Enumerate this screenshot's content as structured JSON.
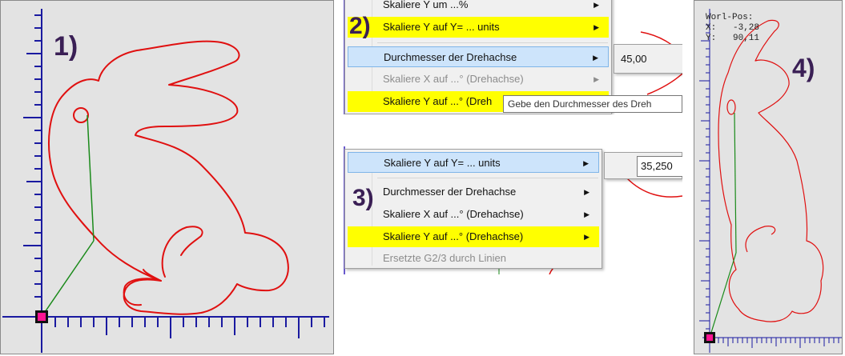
{
  "panel1": {
    "label": "1)"
  },
  "panel2": {
    "label": "2)",
    "menu_items": [
      {
        "label": "Skaliere Y um ...%",
        "state": "normal"
      },
      {
        "label": "Skaliere Y auf Y= ... units",
        "state": "highlighted-yellow"
      },
      {
        "label": "Durchmesser der Drehachse",
        "state": "hover"
      },
      {
        "label": "Skaliere X auf ...° (Drehachse)",
        "state": "disabled"
      },
      {
        "label": "Skaliere Y auf ...° (Dreh",
        "state": "highlighted-yellow"
      }
    ],
    "submenu_value": "45,00",
    "tooltip": "Gebe den Durchmesser des Dreh"
  },
  "panel3": {
    "label": "3)",
    "menu_items": [
      {
        "label": "Skaliere Y auf Y= ... units",
        "state": "hover"
      },
      {
        "label": "Durchmesser der Drehachse",
        "state": "normal"
      },
      {
        "label": "Skaliere X auf ...° (Drehachse)",
        "state": "normal"
      },
      {
        "label": "Skaliere Y auf ...° (Drehachse)",
        "state": "highlighted-yellow"
      },
      {
        "label": "Ersetzte G2/3 durch Linien",
        "state": "disabled"
      }
    ],
    "submenu_value": "35,250"
  },
  "panel4": {
    "label": "4)",
    "pos_title": "Worl-Pos:",
    "pos_x_label": "X:",
    "pos_x_value": "-3,28",
    "pos_y_label": "Y:",
    "pos_y_value": "90,11"
  },
  "colors": {
    "canvas_bg": "#e3e3e3",
    "ruler": "#1a1aa0",
    "contour": "#e01010",
    "path": "#1a8a1a",
    "origin_marker": "#ff1493",
    "highlight_yellow": "#ffff00",
    "hover_blue": "#cde4fb",
    "label_purple": "#3a1f55"
  },
  "icons": [
    "submenu-arrow-icon",
    "origin-marker-icon"
  ]
}
